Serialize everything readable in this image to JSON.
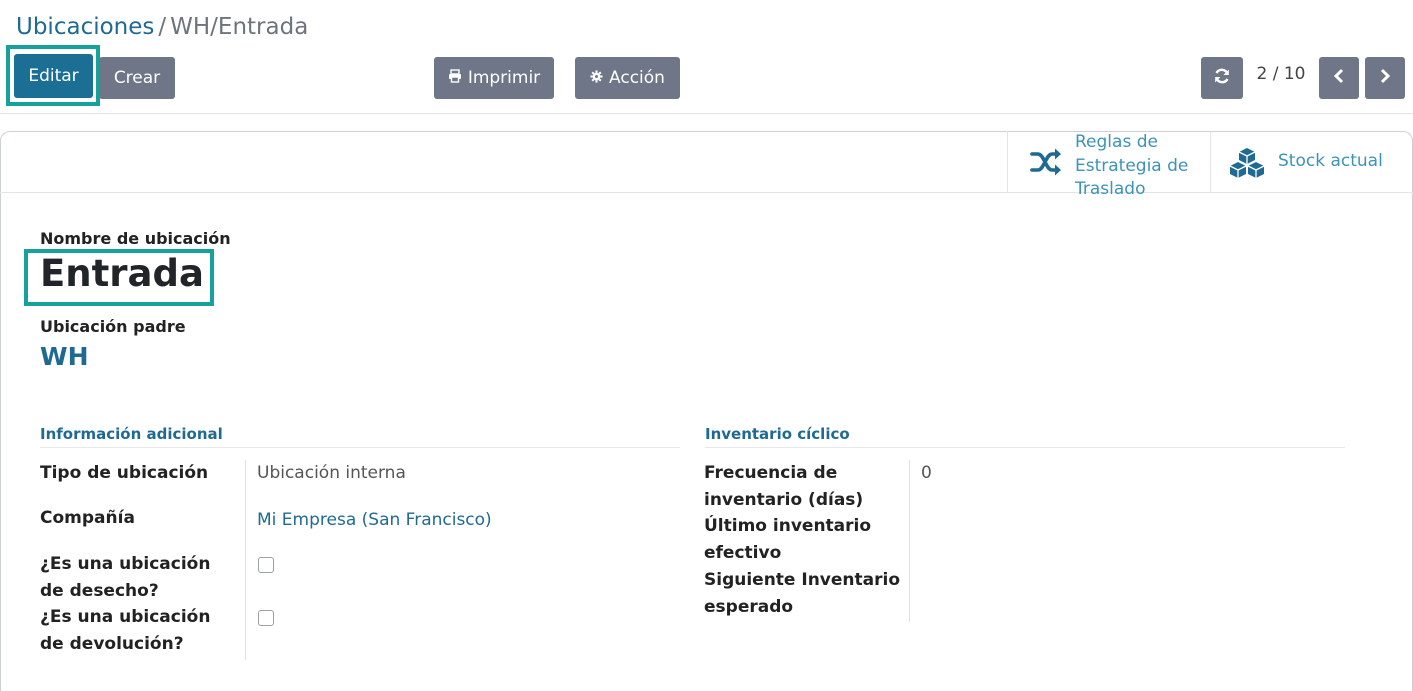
{
  "breadcrumb": {
    "parent": "Ubicaciones",
    "separator": "/",
    "current": "WH/Entrada"
  },
  "toolbar": {
    "edit_label": "Editar",
    "create_label": "Crear",
    "print_label": "Imprimir",
    "action_label": "Acción",
    "print_icon": "printer-icon",
    "action_icon": "gear-icon"
  },
  "pager": {
    "value": "2 / 10",
    "refresh_icon": "refresh-icon",
    "prev_icon": "chevron-left-icon",
    "next_icon": "chevron-right-icon"
  },
  "button_box": {
    "putaway_label_line1": "Reglas de",
    "putaway_label_line2": "Estrategia de",
    "putaway_label_line3": "Traslado",
    "putaway_icon": "shuffle-icon",
    "stock_label": "Stock actual",
    "stock_icon": "cubes-icon"
  },
  "form": {
    "name_label": "Nombre de ubicación",
    "name_value": "Entrada",
    "parent_label": "Ubicación padre",
    "parent_value": "WH",
    "group_info_title": "Información adicional",
    "group_inventory_title": "Inventario cíclico",
    "fields": {
      "type_label": "Tipo de ubicación",
      "type_value": "Ubicación interna",
      "company_label": "Compañía",
      "company_value": "Mi Empresa (San Francisco)",
      "scrap_label_line1": "¿Es una ubicación",
      "scrap_label_line2": "de desecho?",
      "return_label_line1": "¿Es una ubicación",
      "return_label_line2": "de devolución?",
      "frequency_label_line1": "Frecuencia de",
      "frequency_label_line2": "inventario (días)",
      "frequency_value": "0",
      "last_inventory_label_line1": "Último inventario",
      "last_inventory_label_line2": "efectivo",
      "next_inventory_label_line1": "Siguiente Inventario",
      "next_inventory_label_line2": "esperado"
    }
  },
  "colors": {
    "primary": "#1b6f95",
    "secondary": "#6f7688",
    "highlight": "#16a19b",
    "link": "#1f6a93",
    "stat_link": "#3b93b8"
  }
}
